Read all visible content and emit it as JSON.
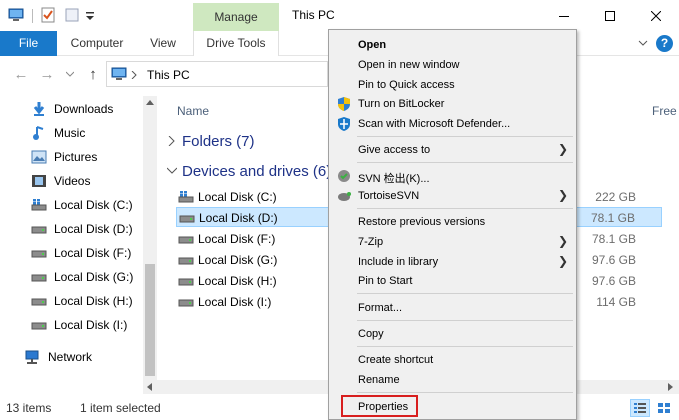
{
  "titlebar": {
    "title": "This PC",
    "manage_tab": "Manage"
  },
  "ribbon": {
    "tabs": [
      {
        "label": "File"
      },
      {
        "label": "Computer"
      },
      {
        "label": "View"
      },
      {
        "label": "Drive Tools"
      }
    ],
    "help": "?"
  },
  "address": {
    "path": "This PC"
  },
  "nav_pane": {
    "items": [
      {
        "label": "Downloads",
        "icon": "download-icon"
      },
      {
        "label": "Music",
        "icon": "music-icon"
      },
      {
        "label": "Pictures",
        "icon": "pictures-icon"
      },
      {
        "label": "Videos",
        "icon": "videos-icon"
      },
      {
        "label": "Local Disk (C:)",
        "icon": "windows-drive-icon"
      },
      {
        "label": "Local Disk (D:)",
        "icon": "drive-icon"
      },
      {
        "label": "Local Disk (F:)",
        "icon": "drive-icon"
      },
      {
        "label": "Local Disk (G:)",
        "icon": "drive-icon"
      },
      {
        "label": "Local Disk (H:)",
        "icon": "drive-icon"
      },
      {
        "label": "Local Disk (I:)",
        "icon": "drive-icon"
      },
      {
        "label": "Network",
        "icon": "network-icon"
      }
    ]
  },
  "content": {
    "col_name": "Name",
    "col_free": "Free",
    "folders_group": "Folders (7)",
    "devices_group": "Devices and drives (6)",
    "drives": [
      {
        "name": "Local Disk (C:)",
        "free": "222 GB",
        "selected": false
      },
      {
        "name": "Local Disk (D:)",
        "free": "78.1 GB",
        "selected": true
      },
      {
        "name": "Local Disk (F:)",
        "free": "78.1 GB",
        "selected": false
      },
      {
        "name": "Local Disk (G:)",
        "free": "97.6 GB",
        "selected": false
      },
      {
        "name": "Local Disk (H:)",
        "free": "97.6 GB",
        "selected": false
      },
      {
        "name": "Local Disk (I:)",
        "free": "114 GB",
        "selected": false
      }
    ]
  },
  "status": {
    "count": "13 items",
    "selection": "1 item selected"
  },
  "context_menu": {
    "items": [
      {
        "label": "Open"
      },
      {
        "label": "Open in new window"
      },
      {
        "label": "Pin to Quick access"
      },
      {
        "label": "Turn on BitLocker"
      },
      {
        "label": "Scan with Microsoft Defender..."
      },
      {
        "label": "Give access to"
      },
      {
        "label": "SVN 检出(K)..."
      },
      {
        "label": "TortoiseSVN"
      },
      {
        "label": "Restore previous versions"
      },
      {
        "label": "7-Zip"
      },
      {
        "label": "Include in library"
      },
      {
        "label": "Pin to Start"
      },
      {
        "label": "Format..."
      },
      {
        "label": "Copy"
      },
      {
        "label": "Create shortcut"
      },
      {
        "label": "Rename"
      },
      {
        "label": "Properties"
      }
    ]
  },
  "colors": {
    "accent": "#1979ca",
    "selection": "#cce8ff",
    "manage_tab": "#cfe8c0",
    "highlight": "#d81e1e"
  }
}
